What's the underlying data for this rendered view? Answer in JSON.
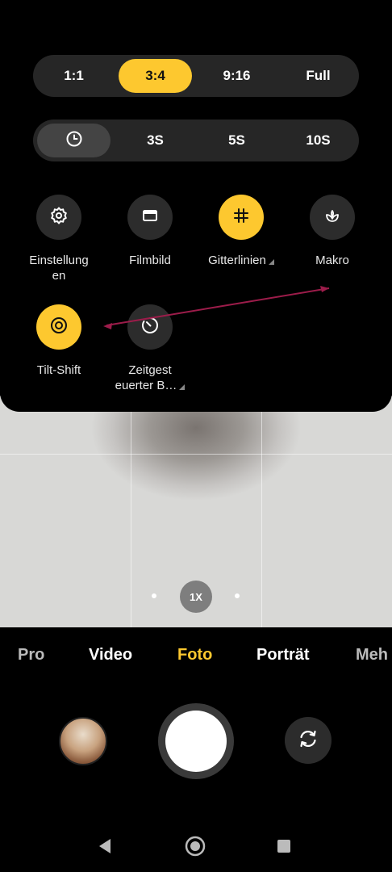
{
  "aspect_ratio": {
    "options": [
      "1:1",
      "3:4",
      "9:16",
      "Full"
    ],
    "selected": "3:4"
  },
  "timer": {
    "options": [
      "3S",
      "5S",
      "10S"
    ],
    "selected_icon": "clock-icon"
  },
  "settings_tiles": [
    {
      "label": "Einstellung\nen",
      "icon": "gear-icon",
      "active": false
    },
    {
      "label": "Filmbild",
      "icon": "frame-icon",
      "active": false
    },
    {
      "label": "Gitterlinien",
      "icon": "grid-icon",
      "active": true
    },
    {
      "label": "Makro",
      "icon": "macro-flower-icon",
      "active": false
    },
    {
      "label": "Tilt-Shift",
      "icon": "tilt-shift-icon",
      "active": true
    },
    {
      "label": "Zeitgest\neuerter B…",
      "icon": "timer-burst-icon",
      "active": false
    }
  ],
  "viewfinder": {
    "zoom_label": "1X"
  },
  "modes": {
    "items": [
      "Pro",
      "Video",
      "Foto",
      "Porträt",
      "Meh"
    ],
    "selected": "Foto"
  },
  "colors": {
    "accent": "#fdc82f",
    "panel": "#000000",
    "chip": "#262626",
    "annotation": "#9c1c4a"
  },
  "nav": {
    "back": "back-icon",
    "home": "home-icon",
    "recents": "recents-icon"
  }
}
